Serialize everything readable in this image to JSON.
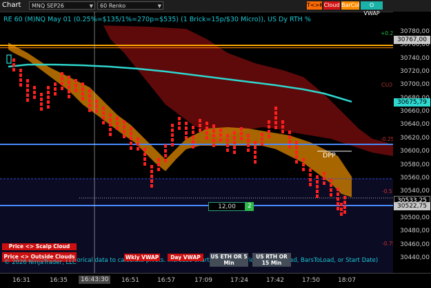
{
  "toolbar": {
    "title": "Chart",
    "instrument": "MNQ SEP26",
    "bar_type": "60 Renko",
    "buttons": [
      {
        "label": "T<>K",
        "bg": "#ff6a00",
        "fg": "#000000"
      },
      {
        "label": "Cloud",
        "bg": "#d21414",
        "fg": "#ffffff"
      },
      {
        "label": "BarCol",
        "bg": "#ff8c00",
        "fg": "#ffffff"
      },
      {
        "label": "O VWAP",
        "bg": "#1bb3a8",
        "fg": "#ffffff"
      }
    ]
  },
  "chart": {
    "info_line": "RE 60 (M)NQ May 01 (0.25%=$135/1%=270p=$535) (1 Brick=15p/$30 Micro)), US Dy RTH %",
    "dpp_label": "DPP",
    "clo_label": "CLO",
    "level_labels": [
      "+0.2",
      "-0.25",
      "-0.5",
      "-0.75"
    ],
    "counter_value": "12,00",
    "counter_badge": "2",
    "notice": "historical data to calculate pivots. Increase chart lookback period (DaysToLoad, BarsToLoad, or Start Date)",
    "copyright": "© 2026 NinjaTrader, LLC",
    "buttons": {
      "scalp_cloud": "Price <> Scalp Cloud",
      "outside_clouds": "Price <> Outside Clouds",
      "wkly_vwap": "Wkly VWAP",
      "day_vwap": "Day VWAP",
      "us_eth_or": "US ETH OR 5 Min",
      "us_rth_or": "US RTH OR 15 Min"
    },
    "colors": {
      "cyan": "#2ed8d0",
      "orange": "#ff9a00",
      "up_bar": "#ff2020",
      "down_bar": "#ff2020",
      "cloud_dark": "#8a1010",
      "blue_line": "#4a8cff"
    }
  },
  "price_axis": {
    "labels": [
      "30780,00",
      "30760,00",
      "30740,00",
      "30720,00",
      "30700,00",
      "30680,00",
      "30660,00",
      "30640,00",
      "30620,00",
      "30600,00",
      "30580,00",
      "30560,00",
      "30540,00",
      "30520,00",
      "30500,00",
      "30480,00",
      "30460,00",
      "30440,00"
    ],
    "tag_top": "30767,00",
    "tag_cyan": "30675,79",
    "tag_last": "30533,25",
    "tag_blue": "30522,75"
  },
  "time_axis": {
    "labels": [
      "16:31",
      "16:35",
      "16:43:30",
      "16:51",
      "16:57",
      "17:09",
      "17:24",
      "17:42",
      "17:50",
      "18:07"
    ]
  }
}
